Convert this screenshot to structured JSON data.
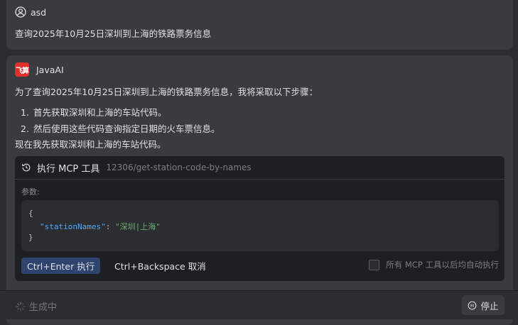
{
  "user_message": {
    "username": "asd",
    "text": "查询2025年10月25日深圳到上海的铁路票务信息"
  },
  "ai_message": {
    "logo_text": "飞算",
    "name": "JavaAI",
    "intro": "为了查询2025年10月25日深圳到上海的铁路票务信息，我将采取以下步骤：",
    "steps": [
      {
        "num": "1.",
        "text": "首先获取深圳和上海的车站代码。"
      },
      {
        "num": "2.",
        "text": "然后使用这些代码查询指定日期的火车票信息。"
      }
    ],
    "closing": "现在我先获取深圳和上海的车站代码。"
  },
  "tool_call": {
    "title": "执行 MCP 工具",
    "tool_name": "12306/get-station-code-by-names",
    "params_label": "参数:",
    "code": {
      "open_brace": "{",
      "key": "\"stationNames\"",
      "colon": ": ",
      "value": "\"深圳|上海\"",
      "close_brace": "}"
    },
    "execute_label": "Ctrl+Enter 执行",
    "cancel_label": "Ctrl+Backspace 取消",
    "auto_exec_label": "所有 MCP 工具以后均自动执行",
    "auto_exec_checked": false
  },
  "footer": {
    "status": "生成中",
    "stop_label": "停止"
  },
  "icons": {
    "user": "user-circle-icon",
    "tool": "history-icon",
    "spinner": "spinner-icon",
    "stop": "pause-circle-icon"
  },
  "colors": {
    "background": "#2b2d30",
    "card": "#393b40",
    "tool_bg": "#1e1f22",
    "primary_button": "#2e436e",
    "logo_red": "#e0302b",
    "json_key": "#56a8f5",
    "json_value": "#6aab73"
  }
}
